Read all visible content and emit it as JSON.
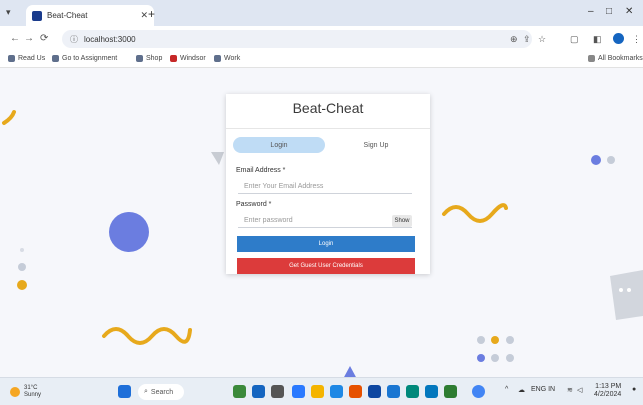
{
  "browser": {
    "tab_title": "Beat-Cheat",
    "tab_close": "✕",
    "new_tab": "+",
    "url": "localhost:3000",
    "bookmarks": [
      "Read Us",
      "Go to Assignment",
      "Shop",
      "Windsor",
      "Work"
    ],
    "all_bookmarks": "All Bookmarks",
    "minimize": "–",
    "maximize": "□",
    "close": "✕"
  },
  "card": {
    "title": "Beat-Cheat",
    "tabs": {
      "login": "Login",
      "signup": "Sign Up"
    },
    "email_label": "Email Address *",
    "email_placeholder": "Enter Your Email Address",
    "password_label": "Password *",
    "password_placeholder": "Enter password",
    "show_label": "Show",
    "login_button": "Login",
    "guest_button": "Get Guest User Credentials"
  },
  "taskbar": {
    "weather_temp": "31°C",
    "weather_desc": "Sunny",
    "search": "Search",
    "time": "1:13 PM",
    "date": "4/2/2024",
    "lang": "ENG IN"
  },
  "colors": {
    "accent_blue": "#2e7cc9",
    "guest_red": "#dc3b3b",
    "deco_blue": "#6b7de0",
    "deco_yellow": "#e7a91c"
  }
}
